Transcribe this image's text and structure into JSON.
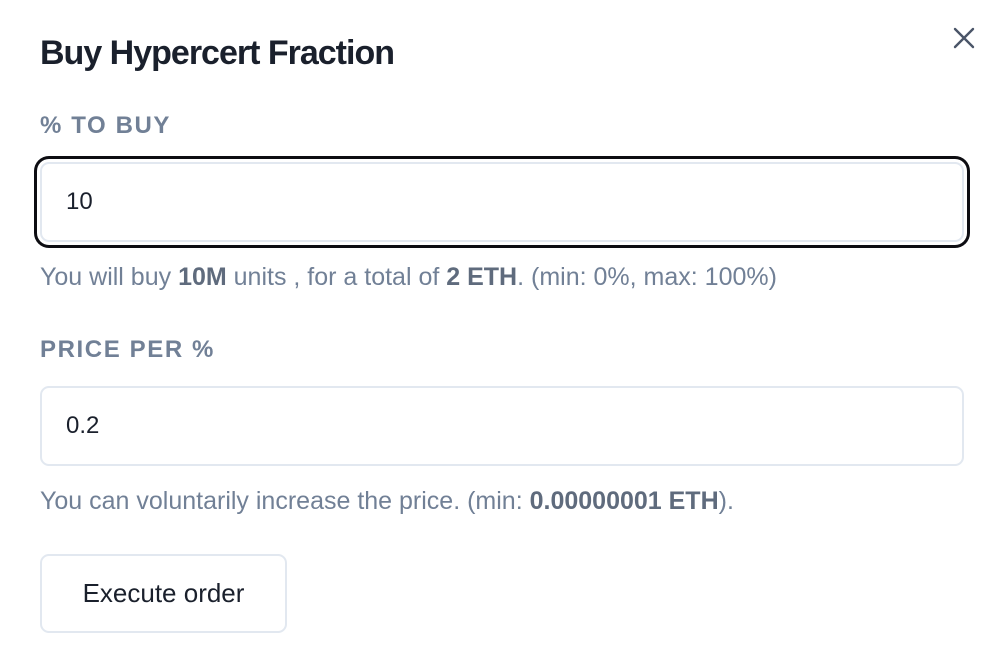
{
  "modal": {
    "title": "Buy Hypercert Fraction",
    "close_icon": "close-icon"
  },
  "percent_field": {
    "label": "% TO BUY",
    "value": "10",
    "focused": true
  },
  "percent_helper": {
    "prefix": "You will buy ",
    "units": "10M",
    "middle": " units , for a total of ",
    "total": "2 ETH",
    "suffix": ". (min: 0%, max: 100%)"
  },
  "price_field": {
    "label": "PRICE PER %",
    "value": "0.2"
  },
  "price_helper": {
    "prefix": "You can voluntarily increase the price. (min: ",
    "min": "0.00000001 ETH",
    "suffix": ")."
  },
  "actions": {
    "execute_label": "Execute order"
  },
  "colors": {
    "heading": "#1a202c",
    "muted": "#718096",
    "border": "#e2e8f0",
    "focus_ring": "#0d0d12"
  }
}
